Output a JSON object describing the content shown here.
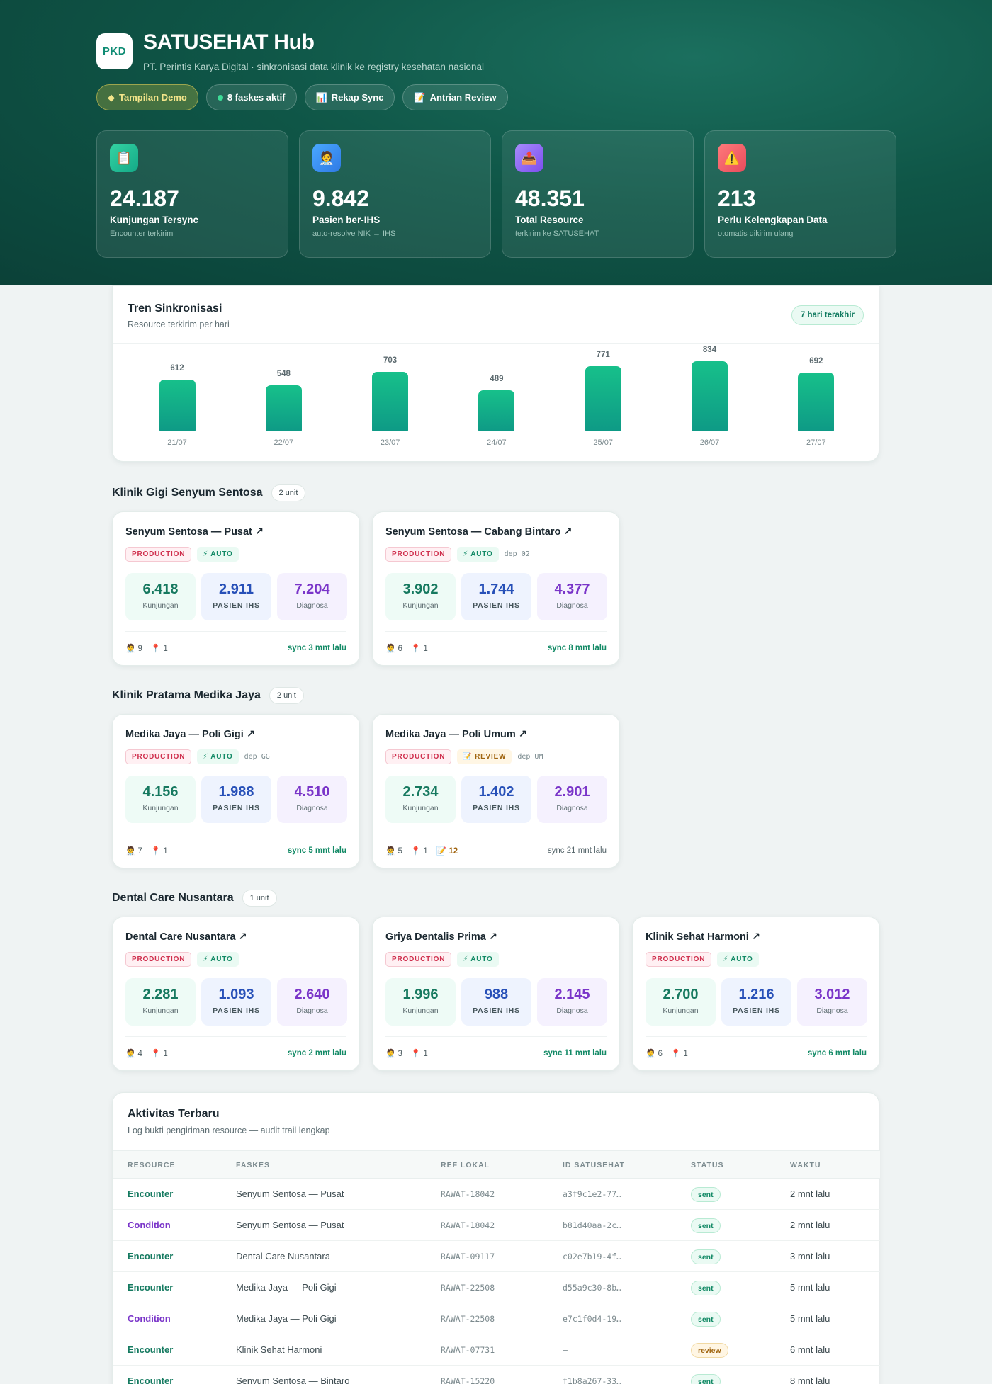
{
  "brand": {
    "logo": "PKD",
    "title": "SATUSEHAT Hub",
    "subtitle": "PT. Perintis Karya Digital · sinkronisasi data klinik ke registry kesehatan nasional"
  },
  "chips": [
    {
      "icon": "◆",
      "icon_name": "diamond-icon",
      "label": "Tampilan Demo"
    },
    {
      "icon": "",
      "icon_name": "active-dot-icon",
      "label": "8 faskes aktif"
    },
    {
      "icon": "📊",
      "icon_name": "bar-chart-icon",
      "label": "Rekap Sync"
    },
    {
      "icon": "📝",
      "icon_name": "memo-icon",
      "label": "Antrian Review"
    }
  ],
  "stats": [
    {
      "icon": "📋",
      "icon_name": "clipboard-icon",
      "value": "24.187",
      "label": "Kunjungan Tersync",
      "sub": "Encounter terkirim"
    },
    {
      "icon": "🧑‍⚕️",
      "icon_name": "health-worker-icon",
      "value": "9.842",
      "label": "Pasien ber-IHS",
      "sub": "auto-resolve NIK → IHS"
    },
    {
      "icon": "📤",
      "icon_name": "outbox-icon",
      "value": "48.351",
      "label": "Total Resource",
      "sub": "terkirim ke SATUSEHAT"
    },
    {
      "icon": "⚠️",
      "icon_name": "warning-icon",
      "value": "213",
      "label": "Perlu Kelengkapan Data",
      "sub": "otomatis dikirim ulang"
    }
  ],
  "trend": {
    "title": "Tren Sinkronisasi",
    "subtitle": "Resource terkirim per hari",
    "range_label": "7 hari terakhir"
  },
  "chart_data": {
    "type": "bar",
    "title": "Tren Sinkronisasi",
    "subtitle": "Resource terkirim per hari",
    "categories": [
      "21/07",
      "22/07",
      "23/07",
      "24/07",
      "25/07",
      "26/07",
      "27/07"
    ],
    "values": [
      612,
      548,
      703,
      489,
      771,
      834,
      692
    ],
    "grid": false,
    "data_labels": true
  },
  "groups": [
    {
      "title": "Klinik Gigi Senyum Sentosa",
      "unit": "2 unit",
      "facilities": [
        {
          "name": "Senyum Sentosa — Pusat ↗",
          "env": "PRODUCTION",
          "mode": "⚡ AUTO",
          "mode_type": "auto",
          "dep": "",
          "kunjungan": "6.418",
          "pasien": "2.911",
          "diagnosa": "7.204",
          "practitioners": "🧑‍⚕️ 9",
          "locations": "📍 1",
          "pending": "",
          "sync": "sync 3 mnt lalu",
          "sync_fresh": true
        },
        {
          "name": "Senyum Sentosa — Cabang Bintaro ↗",
          "env": "PRODUCTION",
          "mode": "⚡ AUTO",
          "mode_type": "auto",
          "dep": "dep 02",
          "kunjungan": "3.902",
          "pasien": "1.744",
          "diagnosa": "4.377",
          "practitioners": "🧑‍⚕️ 6",
          "locations": "📍 1",
          "pending": "",
          "sync": "sync 8 mnt lalu",
          "sync_fresh": true
        }
      ]
    },
    {
      "title": "Klinik Pratama Medika Jaya",
      "unit": "2 unit",
      "facilities": [
        {
          "name": "Medika Jaya — Poli Gigi ↗",
          "env": "PRODUCTION",
          "mode": "⚡ AUTO",
          "mode_type": "auto",
          "dep": "dep GG",
          "kunjungan": "4.156",
          "pasien": "1.988",
          "diagnosa": "4.510",
          "practitioners": "🧑‍⚕️ 7",
          "locations": "📍 1",
          "pending": "",
          "sync": "sync 5 mnt lalu",
          "sync_fresh": true
        },
        {
          "name": "Medika Jaya — Poli Umum ↗",
          "env": "PRODUCTION",
          "mode": "📝 REVIEW",
          "mode_type": "review",
          "dep": "dep UM",
          "kunjungan": "2.734",
          "pasien": "1.402",
          "diagnosa": "2.901",
          "practitioners": "🧑‍⚕️ 5",
          "locations": "📍 1",
          "pending": "📝 12",
          "sync": "sync 21 mnt lalu",
          "sync_fresh": false
        }
      ]
    },
    {
      "title": "Dental Care Nusantara",
      "unit": "1 unit",
      "facilities": [
        {
          "name": "Dental Care Nusantara ↗",
          "env": "PRODUCTION",
          "mode": "⚡ AUTO",
          "mode_type": "auto",
          "dep": "",
          "kunjungan": "2.281",
          "pasien": "1.093",
          "diagnosa": "2.640",
          "practitioners": "🧑‍⚕️ 4",
          "locations": "📍 1",
          "pending": "",
          "sync": "sync 2 mnt lalu",
          "sync_fresh": true
        },
        {
          "name": "Griya Dentalis Prima ↗",
          "env": "PRODUCTION",
          "mode": "⚡ AUTO",
          "mode_type": "auto",
          "dep": "",
          "kunjungan": "1.996",
          "pasien": "988",
          "diagnosa": "2.145",
          "practitioners": "🧑‍⚕️ 3",
          "locations": "📍 1",
          "pending": "",
          "sync": "sync 11 mnt lalu",
          "sync_fresh": true
        },
        {
          "name": "Klinik Sehat Harmoni ↗",
          "env": "PRODUCTION",
          "mode": "⚡ AUTO",
          "mode_type": "auto",
          "dep": "",
          "kunjungan": "2.700",
          "pasien": "1.216",
          "diagnosa": "3.012",
          "practitioners": "🧑‍⚕️ 6",
          "locations": "📍 1",
          "pending": "",
          "sync": "sync 6 mnt lalu",
          "sync_fresh": true
        }
      ]
    }
  ],
  "metric_labels": {
    "kunjungan": "Kunjungan",
    "pasien": "PASIEN IHS",
    "diagnosa": "Diagnosa"
  },
  "activity": {
    "title": "Aktivitas Terbaru",
    "subtitle": "Log bukti pengiriman resource — audit trail lengkap",
    "columns": [
      "RESOURCE",
      "FASKES",
      "REF LOKAL",
      "ID SATUSEHAT",
      "STATUS",
      "WAKTU"
    ],
    "rows": [
      {
        "resource": "Encounter",
        "type": "enc",
        "faskes": "Senyum Sentosa — Pusat",
        "ref": "RAWAT-18042",
        "id": "a3f9c1e2-77…",
        "status": "sent",
        "time": "2 mnt lalu"
      },
      {
        "resource": "Condition",
        "type": "cond",
        "faskes": "Senyum Sentosa — Pusat",
        "ref": "RAWAT-18042",
        "id": "b81d40aa-2c…",
        "status": "sent",
        "time": "2 mnt lalu"
      },
      {
        "resource": "Encounter",
        "type": "enc",
        "faskes": "Dental Care Nusantara",
        "ref": "RAWAT-09117",
        "id": "c02e7b19-4f…",
        "status": "sent",
        "time": "3 mnt lalu"
      },
      {
        "resource": "Encounter",
        "type": "enc",
        "faskes": "Medika Jaya — Poli Gigi",
        "ref": "RAWAT-22508",
        "id": "d55a9c30-8b…",
        "status": "sent",
        "time": "5 mnt lalu"
      },
      {
        "resource": "Condition",
        "type": "cond",
        "faskes": "Medika Jaya — Poli Gigi",
        "ref": "RAWAT-22508",
        "id": "e7c1f0d4-19…",
        "status": "sent",
        "time": "5 mnt lalu"
      },
      {
        "resource": "Encounter",
        "type": "enc",
        "faskes": "Klinik Sehat Harmoni",
        "ref": "RAWAT-07731",
        "id": "—",
        "status": "review",
        "time": "6 mnt lalu"
      },
      {
        "resource": "Encounter",
        "type": "enc",
        "faskes": "Senyum Sentosa — Bintaro",
        "ref": "RAWAT-15220",
        "id": "f1b8a267-33…",
        "status": "sent",
        "time": "8 mnt lalu"
      }
    ]
  },
  "colors": {
    "hero": "#0f5647",
    "accent": "#14a987",
    "production": "#cf2f4d",
    "auto": "#138a66",
    "review": "#a06510"
  }
}
